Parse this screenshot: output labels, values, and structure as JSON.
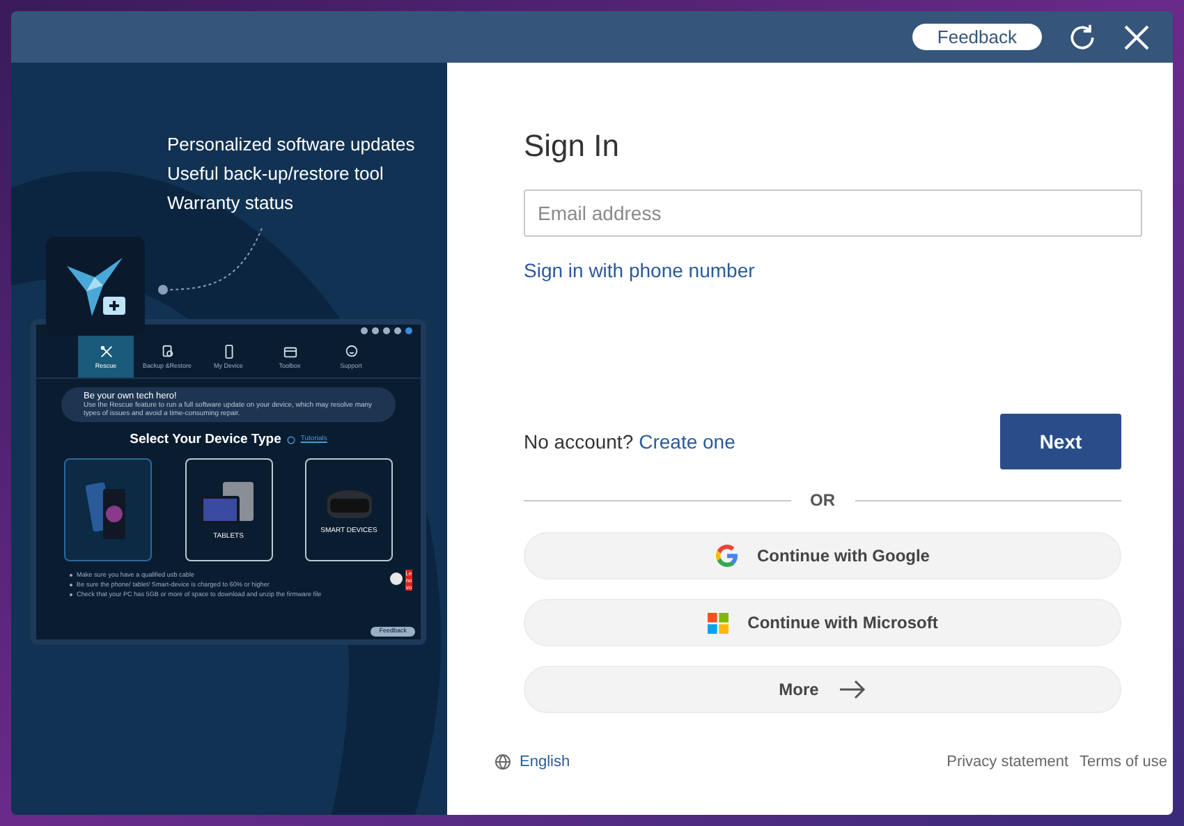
{
  "title_bar": {
    "feedback": "Feedback"
  },
  "promo": {
    "features": [
      "Personalized software updates",
      "Useful back-up/restore tool",
      "Warranty status"
    ],
    "app_preview": {
      "tabs": [
        {
          "kind": "rescue",
          "label": "Rescue",
          "selected": true
        },
        {
          "kind": "backup",
          "label": "Backup &Restore",
          "selected": false
        },
        {
          "kind": "device",
          "label": "My Device",
          "selected": false
        },
        {
          "kind": "toolbox",
          "label": "Toolbox",
          "selected": false
        },
        {
          "kind": "support",
          "label": "Support",
          "selected": false
        }
      ],
      "banner": {
        "title": "Be your own tech hero!",
        "text": "Use the Rescue feature to run a full software update on your device, which may resolve many types of issues and avoid a time-consuming repair."
      },
      "heading": "Select Your Device Type",
      "tutorials": "Tutorials",
      "devices": [
        {
          "kind": "phone",
          "selected": true
        },
        {
          "kind": "tablet",
          "label": "TABLETS",
          "selected": false
        },
        {
          "kind": "headset",
          "label": "SMART DEVICES",
          "selected": false
        }
      ],
      "tips": [
        "Make sure you have a qualified usb cable",
        "Be sure the phone/ tablet/ Smart-device is charged to 60% or higher",
        "Check that your PC has 5GB or more of space to download and unzip the firmware file"
      ],
      "brand_badge": "Lenovo",
      "feedback": "Feedback"
    }
  },
  "sign_in": {
    "title": "Sign In",
    "email": {
      "placeholder": "Email address"
    },
    "phone_link": "Sign in with phone number",
    "no_account": "No account?",
    "create_link": "Create one",
    "next": "Next",
    "or": "OR",
    "providers": [
      {
        "kind": "google",
        "label": "Continue with Google"
      },
      {
        "kind": "microsoft",
        "label": "Continue with Microsoft"
      },
      {
        "kind": "more",
        "label": "More"
      }
    ],
    "footer": {
      "language": "English",
      "links": [
        "Privacy statement",
        "Terms of use"
      ]
    }
  }
}
